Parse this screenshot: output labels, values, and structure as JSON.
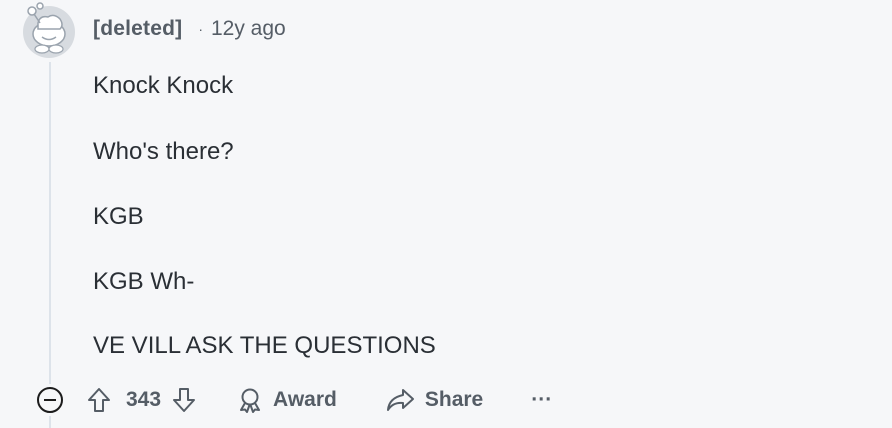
{
  "comment": {
    "author": "[deleted]",
    "separator": "·",
    "age": "12y ago",
    "body": [
      "Knock Knock",
      "Who's there?",
      "KGB",
      "KGB Wh-",
      "VE VILL ASK THE QUESTIONS"
    ],
    "score": "343"
  },
  "actions": {
    "award_label": "Award",
    "share_label": "Share",
    "more_label": "···"
  },
  "icons": {
    "avatar": "deleted-user-avatar-icon",
    "collapse": "collapse-minus-icon",
    "upvote": "upvote-arrow-icon",
    "downvote": "downvote-arrow-icon",
    "award": "award-icon",
    "share": "share-icon"
  },
  "colors": {
    "background": "#f6f7f9",
    "meta_text": "#555d66",
    "body_text": "#2a2f35",
    "thread_line": "#dde3ea"
  }
}
